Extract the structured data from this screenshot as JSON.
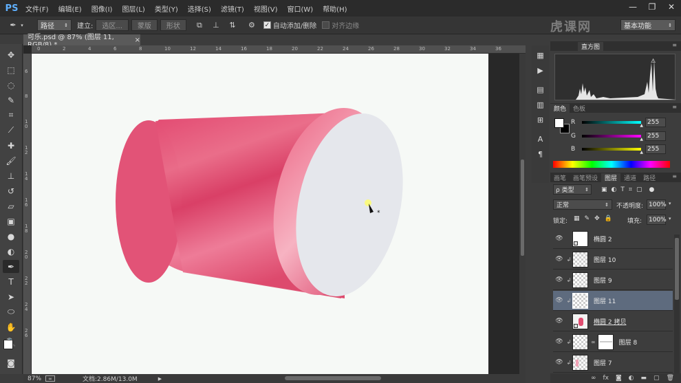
{
  "app": {
    "logo": "PS"
  },
  "menu": [
    "文件(F)",
    "编辑(E)",
    "图像(I)",
    "图层(L)",
    "类型(Y)",
    "选择(S)",
    "滤镜(T)",
    "视图(V)",
    "窗口(W)",
    "帮助(H)"
  ],
  "window_controls": {
    "minimize": "—",
    "restore": "❐",
    "close": "✕"
  },
  "options_bar": {
    "mode_value": "路径",
    "build_label": "建立:",
    "selection_btn": "选区...",
    "mask_btn": "蒙版",
    "shape_btn": "形状",
    "auto_add_checked": true,
    "auto_add_label": "自动添加/删除",
    "align_edges_checked": false,
    "align_edges_label": "对齐边缘",
    "workspace_value": "基本功能"
  },
  "watermark": "虎课网",
  "document": {
    "tab_title": "可乐.psd @ 87% (图层 11, RGB/8) *",
    "tab_close": "×",
    "ruler_top": [
      "0",
      "2",
      "4",
      "6",
      "8",
      "10",
      "12",
      "14",
      "16",
      "18",
      "20",
      "22",
      "24",
      "26",
      "28",
      "30",
      "32",
      "34",
      "36"
    ],
    "ruler_left": [
      "6",
      "8",
      "1 0",
      "1 2",
      "1 4",
      "1 6",
      "1 8",
      "2 0",
      "2 2",
      "2 4",
      "2 6"
    ]
  },
  "status": {
    "zoom": "87%",
    "doc_size": "文档:2.86M/13.0M"
  },
  "panels": {
    "histogram_tab": "直方图",
    "color_tab": "颜色",
    "swatches_tab": "色板",
    "rgb": [
      {
        "label": "R",
        "value": "255",
        "gradient": "linear-gradient(to right, #000, #0ff)"
      },
      {
        "label": "G",
        "value": "255",
        "gradient": "linear-gradient(to right, #000, #f0f)"
      },
      {
        "label": "B",
        "value": "255",
        "gradient": "linear-gradient(to right, #000, #ff0)"
      }
    ],
    "layer_tabs": [
      "画笔",
      "画笔预设",
      "图层",
      "通道",
      "路径"
    ],
    "filter_label": "ρ 类型",
    "blend_mode": "正常",
    "opacity_label": "不透明度:",
    "opacity_value": "100%",
    "lock_label": "锁定:",
    "fill_label": "填充:",
    "fill_value": "100%",
    "layers": [
      {
        "name": "椭圆 2",
        "clipped": false,
        "selected": false,
        "thumb": "shape"
      },
      {
        "name": "图层 10",
        "clipped": true,
        "selected": false,
        "thumb": "transparent"
      },
      {
        "name": "图层 9",
        "clipped": true,
        "selected": false,
        "thumb": "transparent"
      },
      {
        "name": "图层 11",
        "clipped": true,
        "selected": true,
        "thumb": "transparent"
      },
      {
        "name": "椭圆 2 拷贝",
        "clipped": false,
        "selected": false,
        "thumb": "pink"
      },
      {
        "name": "图层 8",
        "clipped": true,
        "selected": false,
        "thumb": "mask"
      },
      {
        "name": "图层 7",
        "clipped": true,
        "selected": false,
        "thumb": "transparent"
      }
    ]
  },
  "colors": {
    "cylinder_side": "#e14d70",
    "cylinder_cap": "#e5e7ec",
    "selection_highlight": "#5e6b7e"
  }
}
